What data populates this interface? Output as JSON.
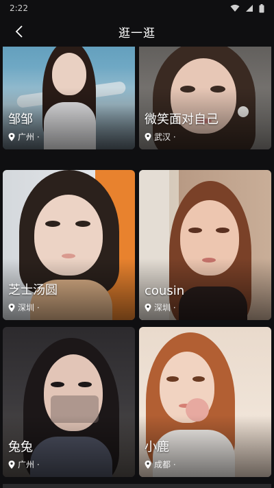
{
  "status": {
    "time": "2:22"
  },
  "nav": {
    "title": "逛一逛"
  },
  "cards": [
    {
      "name": "邹邹",
      "city": "广州 ·",
      "colors": {
        "bg1": "#3a7c9c",
        "bg2": "#a9c6d3",
        "hair": "#2a1c17",
        "skin": "#e9d0c2",
        "top": "#e8e8ea"
      }
    },
    {
      "name": "微笑面对自己",
      "city": "武汉 ·",
      "colors": {
        "bg1": "#5a5a5a",
        "bg2": "#9a9a96",
        "hair": "#3a2a22",
        "skin": "#e7c7b6",
        "top": "#d9d6d2"
      }
    },
    {
      "name": "芝士汤圆",
      "city": "深圳 ·",
      "colors": {
        "bg1": "#d9dde2",
        "bg2": "#e8822e",
        "hair": "#2b211c",
        "skin": "#ecd3c5",
        "top": "#e0b48a"
      }
    },
    {
      "name": "cousin",
      "city": "深圳 ·",
      "colors": {
        "bg1": "#b89a84",
        "bg2": "#d9c6b3",
        "hair": "#7a4128",
        "skin": "#edc6b0",
        "top": "#2a1e1c"
      }
    },
    {
      "name": "兔兔",
      "city": "广州 ·",
      "colors": {
        "bg1": "#3c3a3d",
        "bg2": "#6b6660",
        "hair": "#1c1718",
        "skin": "#e2c5b7",
        "top": "#4c5060"
      }
    },
    {
      "name": "小鹿",
      "city": "成都 ·",
      "colors": {
        "bg1": "#e7d3c3",
        "bg2": "#f3e7dc",
        "hair": "#b25f33",
        "skin": "#f1d3c1",
        "top": "#f4f0ec"
      }
    }
  ]
}
